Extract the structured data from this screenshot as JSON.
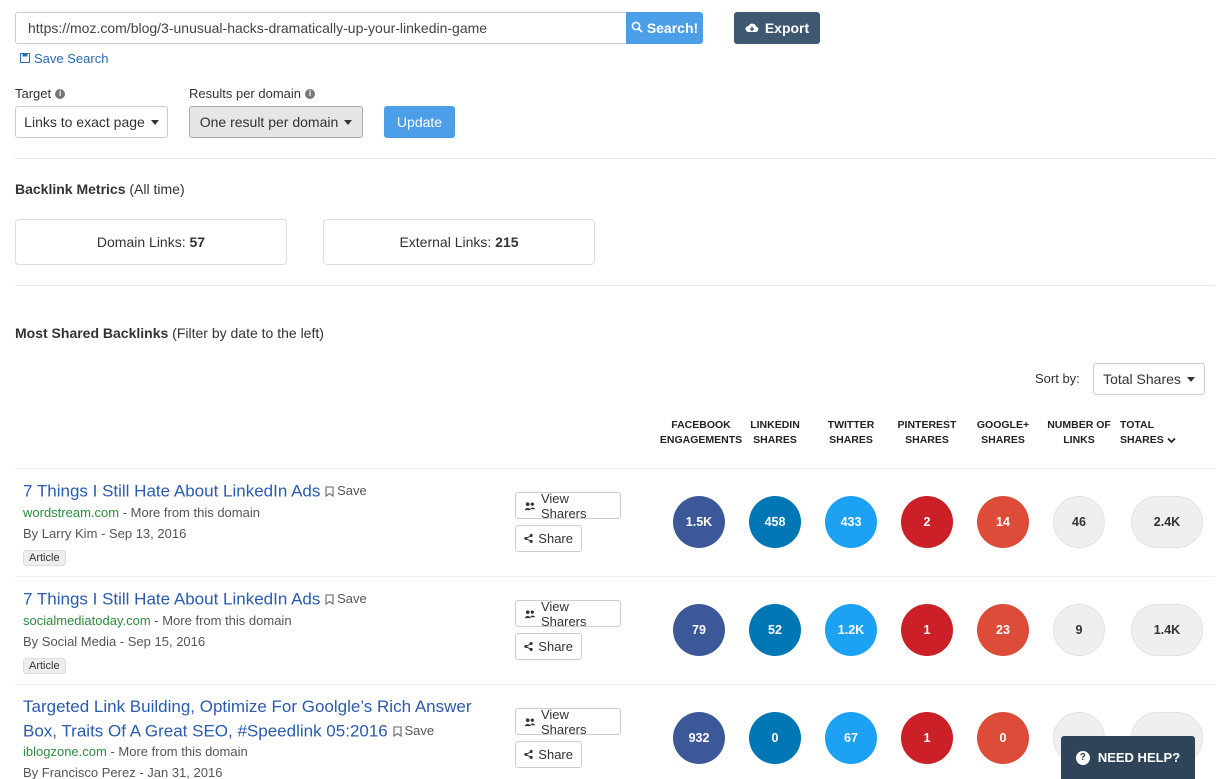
{
  "search": {
    "url": "https://moz.com/blog/3-unusual-hacks-dramatically-up-your-linkedin-game",
    "search_label": "Search!",
    "export_label": "Export",
    "save_search_label": "Save Search"
  },
  "filters": {
    "target_label": "Target",
    "target_value": "Links to exact page",
    "results_label": "Results per domain",
    "results_value": "One result per domain",
    "update_label": "Update"
  },
  "metrics": {
    "title": "Backlink Metrics",
    "subtitle": "(All time)",
    "domain_links_label": "Domain Links:",
    "domain_links_value": "57",
    "external_links_label": "External Links:",
    "external_links_value": "215"
  },
  "shared": {
    "title": "Most Shared Backlinks",
    "subtitle": "(Filter by date to the left)",
    "sort_label": "Sort by:",
    "sort_value": "Total Shares"
  },
  "columns": [
    "FACEBOOK ENGAGEMENTS",
    "LINKEDIN SHARES",
    "TWITTER SHARES",
    "PINTEREST SHARES",
    "GOOGLE+ SHARES",
    "NUMBER OF LINKS",
    "TOTAL SHARES"
  ],
  "colors": {
    "facebook": "#3b5998",
    "linkedin": "#0077b5",
    "twitter": "#1da1f2",
    "pinterest": "#cb2027",
    "google": "#dd4b39",
    "gray": "#efefef"
  },
  "row_buttons": {
    "view_sharers": "View Sharers",
    "share": "Share",
    "save": "Save",
    "more_from_domain": "- More from this domain"
  },
  "rows": [
    {
      "title": "7 Things I Still Hate About LinkedIn Ads",
      "domain": "wordstream.com",
      "author": "By Larry Kim - Sep 13, 2016",
      "tag": "Article",
      "facebook": "1.5K",
      "linkedin": "458",
      "twitter": "433",
      "pinterest": "2",
      "google": "14",
      "links": "46",
      "total": "2.4K"
    },
    {
      "title": "7 Things I Still Hate About LinkedIn Ads",
      "domain": "socialmediatoday.com",
      "author": "By Social Media - Sep 15, 2016",
      "tag": "Article",
      "facebook": "79",
      "linkedin": "52",
      "twitter": "1.2K",
      "pinterest": "1",
      "google": "23",
      "links": "9",
      "total": "1.4K"
    },
    {
      "title": "Targeted Link Building, Optimize For Goolgle’s Rich Answer Box, Traits Of A Great SEO, #Speedlink 05:2016",
      "domain": "iblogzone.com",
      "author": "By Francisco Perez - Jan 31, 2016",
      "tag": "",
      "facebook": "932",
      "linkedin": "0",
      "twitter": "67",
      "pinterest": "1",
      "google": "0",
      "links": "",
      "total": ""
    }
  ],
  "help": {
    "label": "NEED HELP?"
  }
}
